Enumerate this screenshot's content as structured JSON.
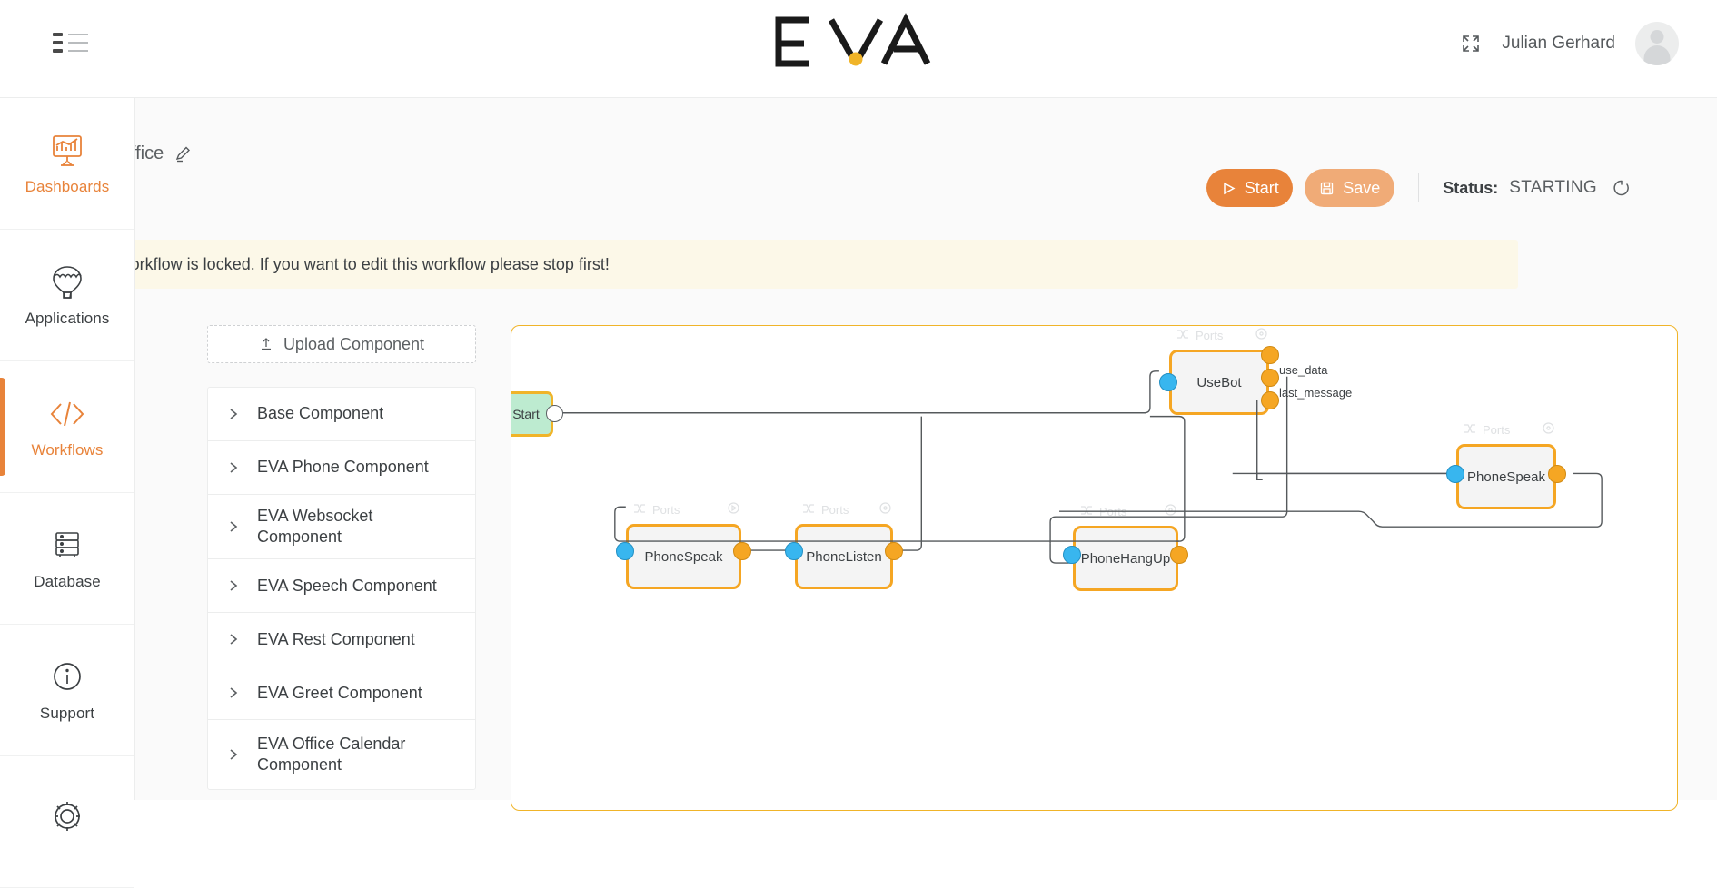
{
  "app": {
    "logo_text": "EVA",
    "menu_icon": "list-menu-icon"
  },
  "header": {
    "fullscreen_icon": "fullscreen-expand-icon",
    "user_name": "Julian Gerhard",
    "avatar_icon": "user-avatar-icon"
  },
  "sidebar": {
    "items": [
      {
        "label": "Dashboards",
        "icon": "monitor-chart-icon",
        "state": "accent"
      },
      {
        "label": "Applications",
        "icon": "hot-air-balloon-icon",
        "state": "normal"
      },
      {
        "label": "Workflows",
        "icon": "code-brackets-icon",
        "state": "active"
      },
      {
        "label": "Database",
        "icon": "database-stack-icon",
        "state": "normal"
      },
      {
        "label": "Support",
        "icon": "info-circle-icon",
        "state": "normal"
      },
      {
        "label": "",
        "icon": "gear-icon",
        "state": "normal"
      }
    ]
  },
  "breadcrumb": {
    "title": "SmartOffice",
    "edit_icon": "pencil-edit-icon"
  },
  "toolbar": {
    "start_label": "Start",
    "start_icon": "play-triangle-icon",
    "save_label": "Save",
    "save_icon": "floppy-save-icon",
    "status_label": "Status:",
    "status_value": "STARTING",
    "status_spinner_icon": "loading-spinner-icon"
  },
  "banner": {
    "icon": "alert-exclamation-icon",
    "text": "Workflow is locked. If you want to edit this workflow please stop first!"
  },
  "components_panel": {
    "upload_label": "Upload Component",
    "upload_icon": "upload-arrow-icon",
    "items": [
      {
        "label": "Base Component"
      },
      {
        "label": "EVA Phone Component"
      },
      {
        "label": "EVA Websocket Component"
      },
      {
        "label": "EVA Speech Component"
      },
      {
        "label": "EVA Rest Component"
      },
      {
        "label": "EVA Greet Component"
      },
      {
        "label": "EVA Office Calendar Component"
      }
    ]
  },
  "canvas": {
    "ports_header_label": "Ports",
    "ports_icon": "shuffle-ports-icon",
    "settings_icon": "settings-circle-icon",
    "nodes": [
      {
        "id": "start",
        "title": "Start",
        "type": "start"
      },
      {
        "id": "usebot",
        "title": "UseBot",
        "type": "component"
      },
      {
        "id": "phonespeak1",
        "title": "PhoneSpeak",
        "type": "component"
      },
      {
        "id": "phonelisten",
        "title": "PhoneListen",
        "type": "component"
      },
      {
        "id": "phonespeak2",
        "title": "PhoneSpeak",
        "type": "component"
      },
      {
        "id": "phonehangup",
        "title": "PhoneHangUp",
        "type": "component"
      }
    ],
    "port_labels": [
      {
        "label": "use_data"
      },
      {
        "label": "last_message"
      }
    ]
  },
  "colors": {
    "accent": "#e8833a",
    "node_border": "#f5a623",
    "canvas_border": "#f0b429",
    "port_in": "#38b6ef",
    "port_out": "#f5a623",
    "start_fill": "#bdebd0",
    "banner_bg": "#fcf8e8"
  }
}
